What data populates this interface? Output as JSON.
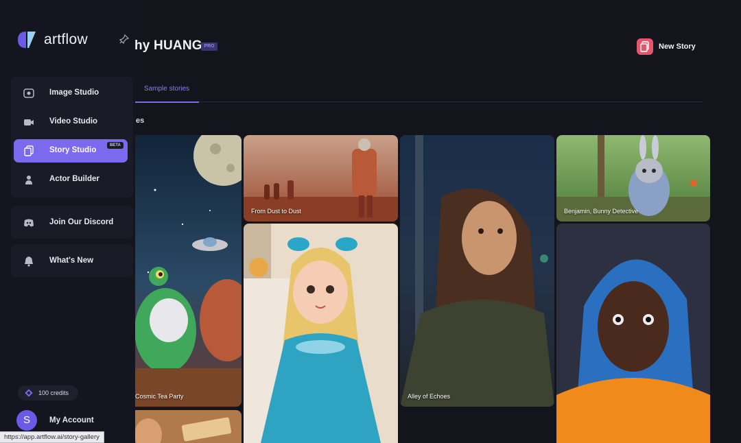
{
  "app": {
    "logo_text": "artflow"
  },
  "header": {
    "title": "hy HUANG",
    "pro_badge": "PRO",
    "new_story_label": "New Story"
  },
  "tabs": [
    {
      "label": "Sample stories",
      "active": true
    }
  ],
  "section": {
    "title": "es"
  },
  "sidebar": {
    "items": [
      {
        "label": "Image Studio",
        "icon": "image-studio-icon"
      },
      {
        "label": "Video Studio",
        "icon": "video-camera-icon"
      },
      {
        "label": "Story Studio",
        "icon": "story-icon",
        "active": true,
        "badge": "BETA"
      },
      {
        "label": "Actor Builder",
        "icon": "person-icon"
      }
    ],
    "discord_label": "Join Our Discord",
    "whats_new_label": "What's New",
    "credits_label": "100 credits",
    "account_label": "My Account",
    "avatar_initial": "S"
  },
  "stories": [
    {
      "caption": "Cosmic Tea Party"
    },
    {
      "caption": "From Dust to Dust"
    },
    {
      "caption": ""
    },
    {
      "caption": ""
    },
    {
      "caption": "Alley of Echoes"
    },
    {
      "caption": "Benjamin, Bunny Detective"
    },
    {
      "caption": ""
    }
  ],
  "status_bar": {
    "url": "https://app.artflow.ai/story-gallery"
  },
  "colors": {
    "accent": "#7b69ee",
    "background": "#14141d",
    "sidebar": "#15151f",
    "new_story_icon": "#e5566d"
  }
}
